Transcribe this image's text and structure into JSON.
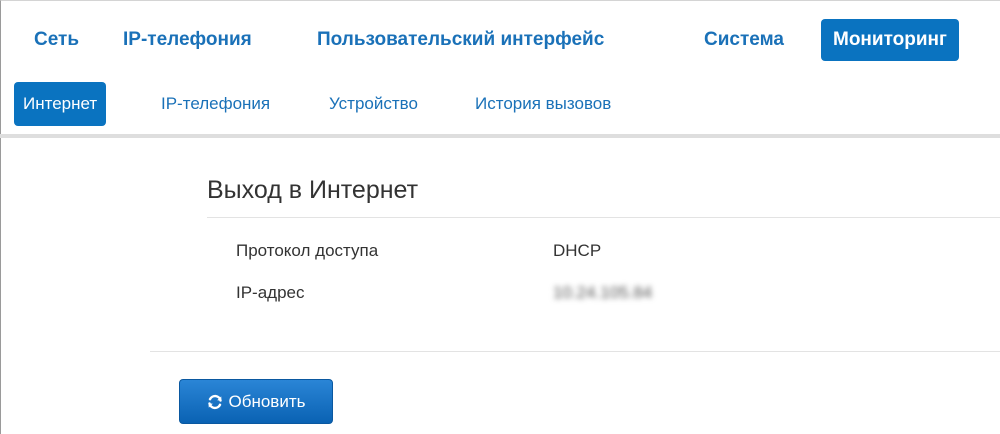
{
  "top_nav": {
    "items": [
      {
        "label": "Сеть",
        "active": false
      },
      {
        "label": "IP-телефония",
        "active": false
      },
      {
        "label": "Пользовательский интерфейс",
        "active": false
      },
      {
        "label": "Система",
        "active": false
      },
      {
        "label": "Мониторинг",
        "active": true
      }
    ]
  },
  "sub_nav": {
    "items": [
      {
        "label": "Интернет",
        "active": true
      },
      {
        "label": "IP-телефония",
        "active": false
      },
      {
        "label": "Устройство",
        "active": false
      },
      {
        "label": "История вызовов",
        "active": false
      }
    ]
  },
  "section": {
    "title": "Выход в Интернет",
    "rows": [
      {
        "label": "Протокол доступа",
        "value": "DHCP"
      },
      {
        "label": "IP-адрес",
        "value": "10.24.105.84"
      }
    ]
  },
  "actions": {
    "refresh_label": "Обновить",
    "refresh_icon": "refresh-icon"
  },
  "colors": {
    "accent": "#0a73c0",
    "link": "#1a71b8",
    "text": "#333333"
  }
}
